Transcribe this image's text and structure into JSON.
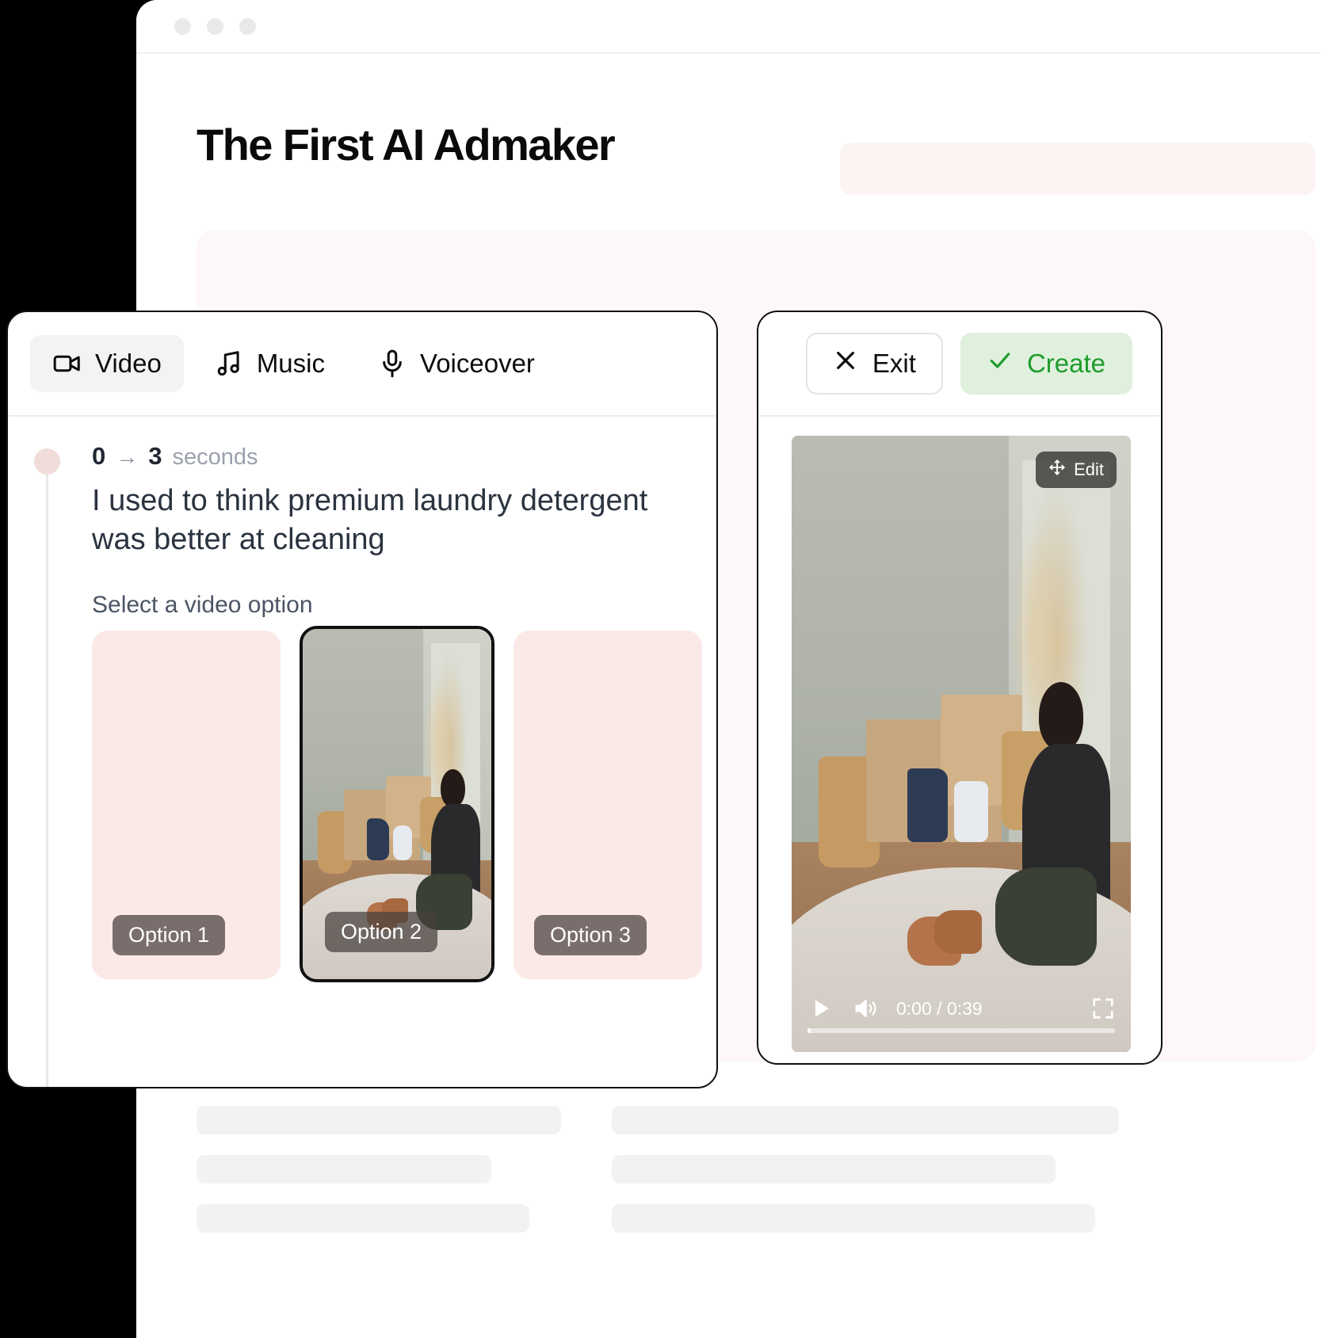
{
  "browser": {
    "traffic_lights": [
      "dot-1",
      "dot-2",
      "dot-3"
    ],
    "page_title": "The First AI Admaker"
  },
  "editor": {
    "tabs": [
      {
        "label": "Video",
        "icon": "video-camera-icon",
        "active": true
      },
      {
        "label": "Music",
        "icon": "music-note-icon",
        "active": false
      },
      {
        "label": "Voiceover",
        "icon": "microphone-icon",
        "active": false
      }
    ],
    "segment": {
      "start": "0",
      "arrow": "→",
      "end": "3",
      "unit": "seconds",
      "script": "I used to think premium laundry detergent was better at cleaning",
      "options_label": "Select a video option",
      "options": [
        {
          "label": "Option 1",
          "selected": false,
          "has_thumbnail": false
        },
        {
          "label": "Option 2",
          "selected": true,
          "has_thumbnail": true
        },
        {
          "label": "Option 3",
          "selected": false,
          "has_thumbnail": false
        }
      ]
    }
  },
  "preview": {
    "exit_label": "Exit",
    "create_label": "Create",
    "exit_icon": "close-x-icon",
    "create_icon": "check-icon",
    "edit_label": "Edit",
    "edit_icon": "move-arrows-icon",
    "player": {
      "play_icon": "play-icon",
      "volume_icon": "volume-icon",
      "fullscreen_icon": "fullscreen-icon",
      "current_time": "0:00",
      "separator": "/",
      "duration": "0:39",
      "timecode": "0:00 / 0:39",
      "progress_percent": 1
    }
  },
  "colors": {
    "accent_green": "#1f9c2c",
    "green_bg": "#dff0dd",
    "option_pink": "#fae9e6",
    "timeline_dot": "#f0dcd9",
    "border_dark": "#111111",
    "text_dark": "#2b3340"
  }
}
